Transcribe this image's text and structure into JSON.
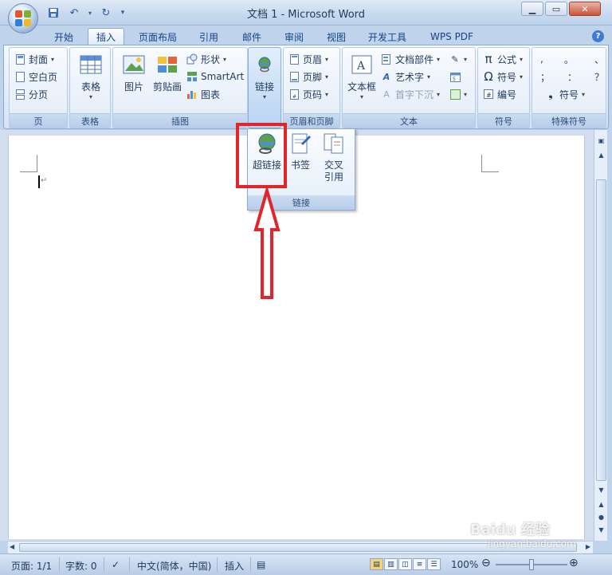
{
  "window": {
    "title": "文档 1 - Microsoft Word"
  },
  "qat": {
    "save": "save-icon",
    "undo": "undo-icon",
    "redo": "redo-icon"
  },
  "tabs": [
    {
      "label": "开始"
    },
    {
      "label": "插入"
    },
    {
      "label": "页面布局"
    },
    {
      "label": "引用"
    },
    {
      "label": "邮件"
    },
    {
      "label": "审阅"
    },
    {
      "label": "视图"
    },
    {
      "label": "开发工具"
    },
    {
      "label": "WPS PDF"
    }
  ],
  "active_tab": "插入",
  "ribbon": {
    "page": {
      "label": "页",
      "cover": "封面",
      "blank": "空白页",
      "break": "分页"
    },
    "table": {
      "label": "表格",
      "table": "表格"
    },
    "illus": {
      "label": "插图",
      "picture": "图片",
      "clipart": "剪贴画",
      "shapes": "形状",
      "smartart": "SmartArt",
      "chart": "图表"
    },
    "link": {
      "button": "链接"
    },
    "hf": {
      "label": "页眉和页脚",
      "header": "页眉",
      "footer": "页脚",
      "pagenum": "页码"
    },
    "text": {
      "label": "文本",
      "textbox": "文本框",
      "parts": "文档部件",
      "wordart": "艺术字",
      "dropcap": "首字下沉"
    },
    "symbols": {
      "label": "符号",
      "equation": "公式",
      "symbol": "符号",
      "number": "编号"
    },
    "special": {
      "label": "特殊符号",
      "chars": [
        ",",
        "。",
        "、",
        "；",
        "：",
        "？"
      ],
      "symbol": "符号"
    }
  },
  "dropdown": {
    "hyperlink": "超链接",
    "bookmark": "书签",
    "crossref_1": "交叉",
    "crossref_2": "引用",
    "label": "链接"
  },
  "status": {
    "page": "页面: 1/1",
    "words": "字数: 0",
    "language": "中文(简体，中国)",
    "mode": "插入",
    "zoom": "100%"
  },
  "watermark": {
    "brand": "Baidu 经验",
    "url": "jingyan.baidu.com"
  },
  "colors": {
    "highlight": "#e0262a",
    "ribbon_border": "#8ba9d4",
    "tab_text": "#15428b"
  }
}
